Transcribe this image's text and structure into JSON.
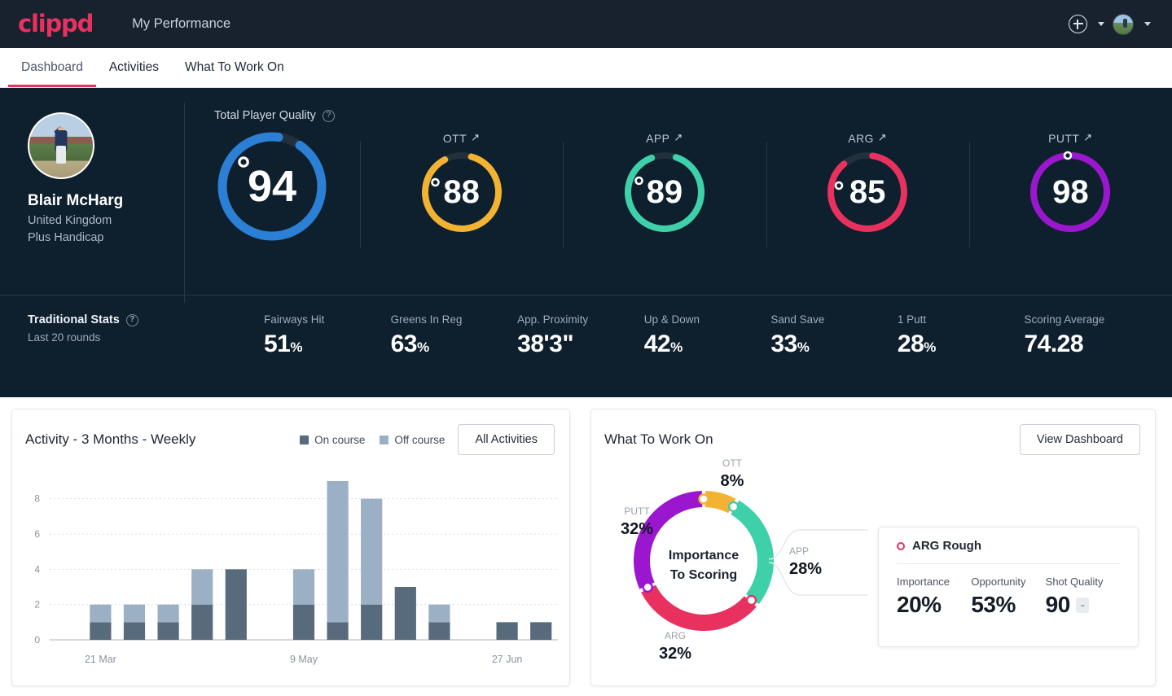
{
  "brand": {
    "logo_text": "clippd",
    "accent": "#e8315f"
  },
  "header": {
    "app_title": "My Performance",
    "add_icon": "plus-circle-icon",
    "add_caret_icon": "chevron-down-icon",
    "avatar_icon": "user-avatar",
    "avatar_caret_icon": "chevron-down-icon"
  },
  "tabs": [
    {
      "label": "Dashboard",
      "active": true
    },
    {
      "label": "Activities",
      "active": false
    },
    {
      "label": "What To Work On",
      "active": false
    }
  ],
  "profile": {
    "name": "Blair McHarg",
    "country": "United Kingdom",
    "handicap": "Plus Handicap",
    "avatar_icon": "golfer-avatar"
  },
  "player_quality": {
    "section_label": "Total Player Quality",
    "help_icon": "question-circle-icon",
    "main": {
      "label": "",
      "value": "94",
      "color": "#2b7fd4",
      "track": "#22303e",
      "marker_angle": -35
    },
    "metrics": [
      {
        "label": "OTT",
        "value": "88",
        "color": "#f2b332",
        "track": "#22303e",
        "trend_icon": "arrow-up-right-icon",
        "marker_angle": -55
      },
      {
        "label": "APP",
        "value": "89",
        "color": "#3ed0a8",
        "track": "#22303e",
        "trend_icon": "arrow-up-right-icon",
        "marker_angle": -52
      },
      {
        "label": "ARG",
        "value": "85",
        "color": "#e8315f",
        "track": "#22303e",
        "trend_icon": "arrow-up-right-icon",
        "marker_angle": -62
      },
      {
        "label": "PUTT",
        "value": "98",
        "color": "#9b17cf",
        "track": "#22303e",
        "trend_icon": "arrow-up-right-icon",
        "marker_angle": -6
      }
    ]
  },
  "traditional_stats": {
    "title": "Traditional Stats",
    "help_icon": "question-circle-icon",
    "subtitle": "Last 20 rounds",
    "items": [
      {
        "label": "Fairways Hit",
        "value": "51",
        "unit": "%"
      },
      {
        "label": "Greens In Reg",
        "value": "63",
        "unit": "%"
      },
      {
        "label": "App. Proximity",
        "value": "38'3\"",
        "unit": ""
      },
      {
        "label": "Up & Down",
        "value": "42",
        "unit": "%"
      },
      {
        "label": "Sand Save",
        "value": "33",
        "unit": "%"
      },
      {
        "label": "1 Putt",
        "value": "28",
        "unit": "%"
      },
      {
        "label": "Scoring Average",
        "value": "74.28",
        "unit": ""
      }
    ]
  },
  "activity_card": {
    "title": "Activity - 3 Months - Weekly",
    "legend": [
      {
        "label": "On course",
        "color": "#586b7d"
      },
      {
        "label": "Off course",
        "color": "#9bb0c4"
      }
    ],
    "button": "All Activities"
  },
  "what_to_work_on": {
    "title": "What To Work On",
    "button": "View Dashboard",
    "center_line1": "Importance",
    "center_line2": "To Scoring",
    "detail": {
      "title": "ARG Rough",
      "dot_icon": "circle-outline-icon",
      "marker_color": "#e8315f",
      "metrics": [
        {
          "label": "Importance",
          "value": "20%"
        },
        {
          "label": "Opportunity",
          "value": "53%"
        },
        {
          "label": "Shot Quality",
          "value": "90",
          "badge": "-"
        }
      ]
    }
  },
  "chart_data": [
    {
      "type": "bar",
      "title": "Activity - 3 Months - Weekly",
      "stacked": true,
      "categories": [
        "",
        "21 Mar",
        "",
        "",
        "",
        "",
        "",
        "9 May",
        "",
        "",
        "",
        "",
        "",
        "27 Jun",
        ""
      ],
      "tick_labels": [
        {
          "index": 1,
          "label": "21 Mar"
        },
        {
          "index": 7,
          "label": "9 May"
        },
        {
          "index": 13,
          "label": "27 Jun"
        }
      ],
      "series": [
        {
          "name": "On course",
          "color": "#586b7d",
          "values": [
            0,
            1,
            1,
            1,
            2,
            4,
            0,
            2,
            1,
            2,
            3,
            1,
            0,
            1,
            1
          ]
        },
        {
          "name": "Off course",
          "color": "#9bb0c4",
          "values": [
            0,
            1,
            1,
            1,
            2,
            0,
            0,
            2,
            8,
            6,
            0,
            1,
            0,
            0,
            0
          ]
        }
      ],
      "xlabel": "",
      "ylabel": "",
      "ylim": [
        0,
        9
      ],
      "yticks": [
        0,
        2,
        4,
        6,
        8
      ],
      "grid": true,
      "legend_position": "top-right"
    },
    {
      "type": "pie",
      "title": "Importance To Scoring",
      "donut": true,
      "labels": [
        "OTT",
        "APP",
        "ARG",
        "PUTT"
      ],
      "values": [
        8,
        28,
        32,
        32
      ],
      "value_labels": [
        "8%",
        "28%",
        "32%",
        "32%"
      ],
      "colors": [
        "#f2b332",
        "#3ed0a8",
        "#e8315f",
        "#9b17cf"
      ],
      "legend_position": "around"
    }
  ]
}
